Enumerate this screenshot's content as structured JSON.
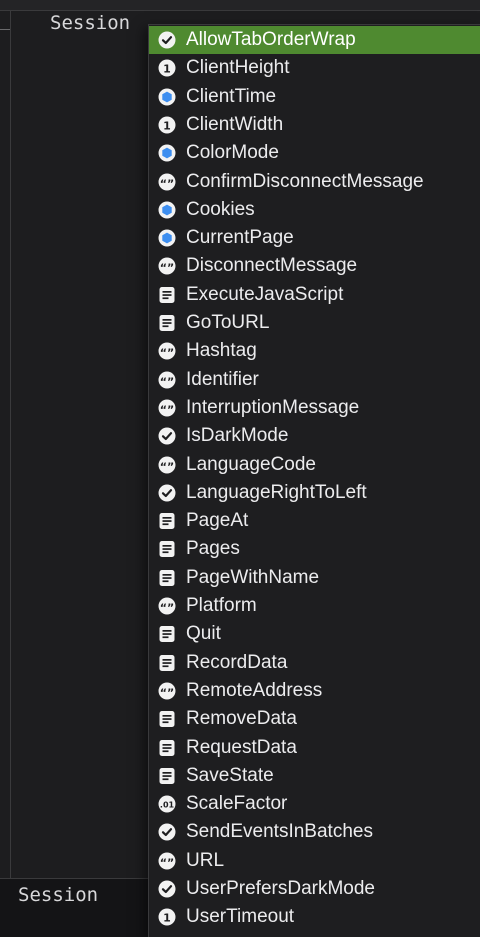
{
  "editor": {
    "code_line_top": "Session",
    "code_line_bottom": "Session"
  },
  "autocomplete": {
    "items": [
      {
        "label": "AllowTabOrderWrap",
        "icon": "boolean-check-icon",
        "selected": true
      },
      {
        "label": "ClientHeight",
        "icon": "integer-icon"
      },
      {
        "label": "ClientTime",
        "icon": "class-hexagon-icon"
      },
      {
        "label": "ClientWidth",
        "icon": "integer-icon"
      },
      {
        "label": "ColorMode",
        "icon": "class-hexagon-icon"
      },
      {
        "label": "ConfirmDisconnectMessage",
        "icon": "string-quote-icon"
      },
      {
        "label": "Cookies",
        "icon": "class-hexagon-icon"
      },
      {
        "label": "CurrentPage",
        "icon": "class-hexagon-icon"
      },
      {
        "label": "DisconnectMessage",
        "icon": "string-quote-icon"
      },
      {
        "label": "ExecuteJavaScript",
        "icon": "method-doc-icon"
      },
      {
        "label": "GoToURL",
        "icon": "method-doc-icon"
      },
      {
        "label": "Hashtag",
        "icon": "string-quote-icon"
      },
      {
        "label": "Identifier",
        "icon": "string-quote-icon"
      },
      {
        "label": "InterruptionMessage",
        "icon": "string-quote-icon"
      },
      {
        "label": "IsDarkMode",
        "icon": "boolean-check-icon"
      },
      {
        "label": "LanguageCode",
        "icon": "string-quote-icon"
      },
      {
        "label": "LanguageRightToLeft",
        "icon": "boolean-check-icon"
      },
      {
        "label": "PageAt",
        "icon": "method-doc-icon"
      },
      {
        "label": "Pages",
        "icon": "method-doc-icon"
      },
      {
        "label": "PageWithName",
        "icon": "method-doc-icon"
      },
      {
        "label": "Platform",
        "icon": "string-quote-icon"
      },
      {
        "label": "Quit",
        "icon": "method-doc-icon"
      },
      {
        "label": "RecordData",
        "icon": "method-doc-icon"
      },
      {
        "label": "RemoteAddress",
        "icon": "string-quote-icon"
      },
      {
        "label": "RemoveData",
        "icon": "method-doc-icon"
      },
      {
        "label": "RequestData",
        "icon": "method-doc-icon"
      },
      {
        "label": "SaveState",
        "icon": "method-doc-icon"
      },
      {
        "label": "ScaleFactor",
        "icon": "double-icon"
      },
      {
        "label": "SendEventsInBatches",
        "icon": "boolean-check-icon"
      },
      {
        "label": "URL",
        "icon": "string-quote-icon"
      },
      {
        "label": "UserPrefersDarkMode",
        "icon": "boolean-check-icon"
      },
      {
        "label": "UserTimeout",
        "icon": "integer-icon"
      }
    ],
    "colors": {
      "selected_bg": "#4f8a30",
      "hexagon_blue": "#3d8ef0"
    }
  }
}
